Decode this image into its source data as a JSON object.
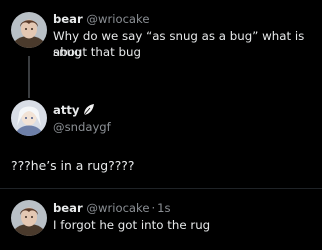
{
  "tweet1": {
    "name": "bear",
    "handle": "@wriocake",
    "text_line1": "Why do we say “as snug as a bug” what is snug",
    "text_line2": "about that bug"
  },
  "reply": {
    "name": "atty",
    "handle": "@sndaygf",
    "text": "???he’s in a rug????"
  },
  "tweet2": {
    "name": "bear",
    "handle": "@wriocake",
    "separator": "·",
    "time": "1s",
    "text": "I forgot he got into the rug"
  },
  "colors": {
    "background": "#000000",
    "text": "#e7e9ea",
    "secondary_text": "#8b8f94"
  }
}
